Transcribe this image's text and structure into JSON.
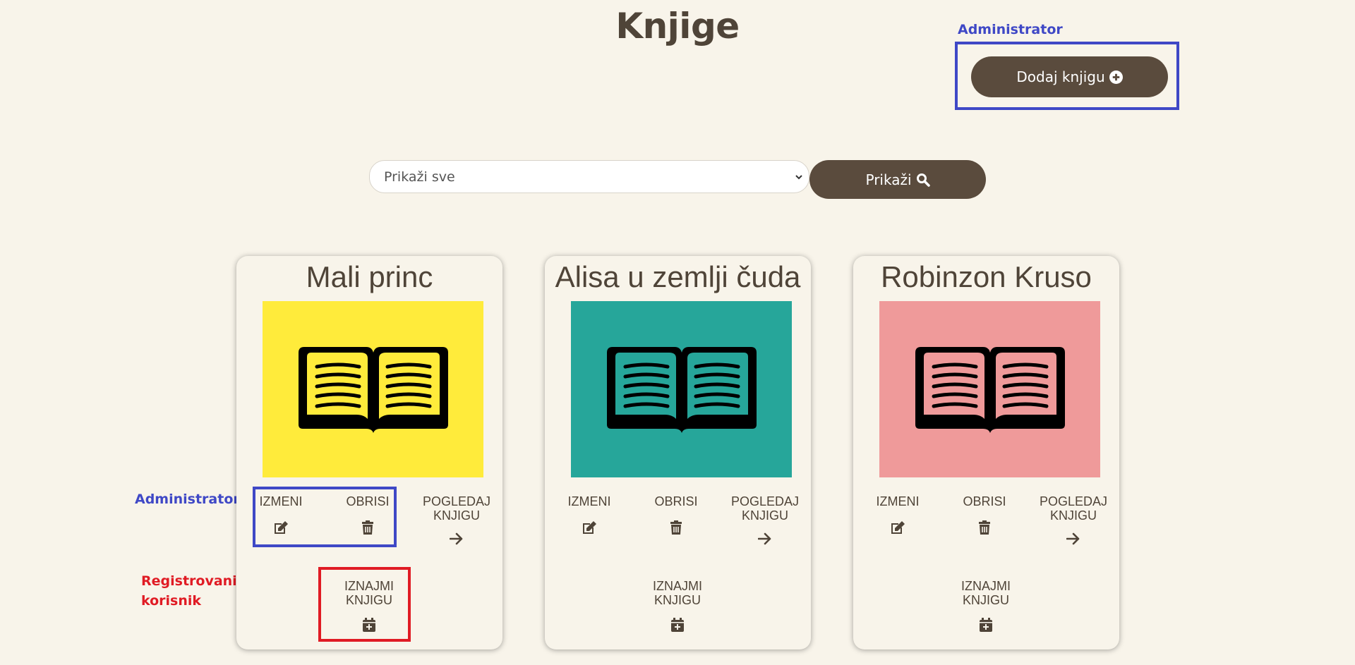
{
  "page": {
    "title": "Knjige"
  },
  "annotations": {
    "admin_top": "Administrator",
    "admin_left": "Administrator",
    "registered_line1": "Registrovani",
    "registered_line2": "korisnik"
  },
  "header": {
    "add_button_label": "Dodaj knjigu",
    "add_icon": "plus-circle-icon"
  },
  "filter": {
    "selected": "Prikaži sve",
    "show_button_label": "Prikaži",
    "search_icon": "search-icon"
  },
  "books": [
    {
      "title": "Mali princ",
      "cover_color": "#ffeb3b",
      "edit": "IZMENI",
      "delete": "OBRISI",
      "view_line1": "POGLEDAJ",
      "view_line2": "KNJIGU",
      "rent_line1": "IZNAJMI",
      "rent_line2": "KNJIGU"
    },
    {
      "title": "Alisa u zemlji čuda",
      "cover_color": "#26a69a",
      "edit": "IZMENI",
      "delete": "OBRISI",
      "view_line1": "POGLEDAJ",
      "view_line2": "KNJIGU",
      "rent_line1": "IZNAJMI",
      "rent_line2": "KNJIGU"
    },
    {
      "title": "Robinzon Kruso",
      "cover_color": "#ef9a9a",
      "edit": "IZMENI",
      "delete": "OBRISI",
      "view_line1": "POGLEDAJ",
      "view_line2": "KNJIGU",
      "rent_line1": "IZNAJMI",
      "rent_line2": "KNJIGU"
    }
  ],
  "colors": {
    "background": "#f8f4ea",
    "primary": "#5a4b3d",
    "admin_annotation": "#3f48c6",
    "user_annotation": "#e01b24"
  }
}
